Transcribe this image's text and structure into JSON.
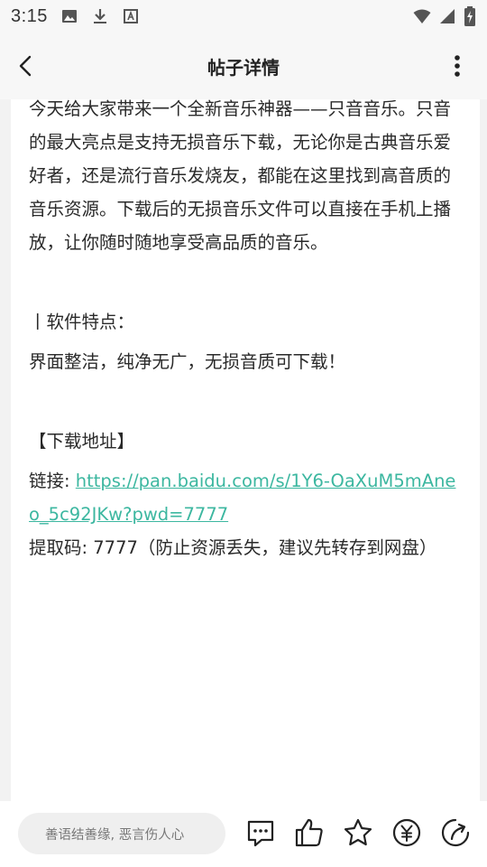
{
  "status_bar": {
    "time": "3:15"
  },
  "app_bar": {
    "title": "帖子详情"
  },
  "post": {
    "intro": "今天给大家带来一个全新音乐神器——只音音乐。只音的最大亮点是支持无损音乐下载，无论你是古典音乐爱好者，还是流行音乐发烧友，都能在这里找到高音质的音乐资源。下载后的无损音乐文件可以直接在手机上播放，让你随时随地享受高品质的音乐。",
    "features_heading": "丨软件特点：",
    "features_text": "界面整洁，纯净无广，无损音质可下载！",
    "download_heading": "【下载地址】",
    "link_label": "链接: ",
    "link_url": "https://pan.baidu.com/s/1Y6-OaXuM5mAneo_5c92JKw?pwd=7777",
    "code_line": "提取码: 7777（防止资源丢失，建议先转存到网盘）"
  },
  "bottom_bar": {
    "comment_placeholder": "善语结善缘, 恶言伤人心"
  },
  "colors": {
    "link": "#3cb7a0",
    "background": "#f2f2f2",
    "card": "#ffffff"
  },
  "icons": [
    "image-icon",
    "download-icon",
    "font-icon",
    "wifi-icon",
    "signal-icon",
    "battery-icon",
    "back-arrow-icon",
    "more-vertical-icon",
    "comment-icon",
    "like-icon",
    "star-icon",
    "reward-icon",
    "share-icon"
  ]
}
